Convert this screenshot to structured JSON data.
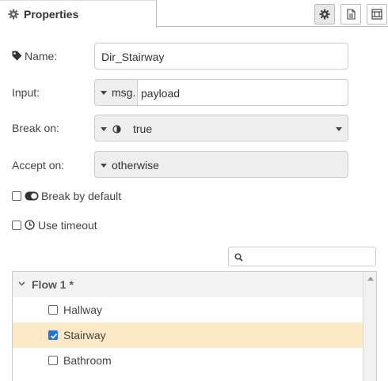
{
  "header": {
    "tab_label": "Properties",
    "buttons": [
      {
        "name": "settings",
        "icon": "gear-icon"
      },
      {
        "name": "description",
        "icon": "file-icon"
      },
      {
        "name": "appearance",
        "icon": "frame-icon"
      }
    ]
  },
  "form": {
    "name": {
      "label": "Name:",
      "value": "Dir_Stairway"
    },
    "input": {
      "label": "Input:",
      "type": "msg.",
      "value": "payload"
    },
    "break_on": {
      "label": "Break on:",
      "value": "true"
    },
    "accept_on": {
      "label": "Accept on:",
      "value": "otherwise"
    },
    "break_by_default": {
      "label": "Break by default",
      "checked": false
    },
    "use_timeout": {
      "label": "Use timeout",
      "checked": false
    }
  },
  "search": {
    "placeholder": ""
  },
  "tree": {
    "flow": {
      "label": "Flow 1 *",
      "expanded": true
    },
    "items": [
      {
        "label": "Hallway",
        "checked": false,
        "selected": false
      },
      {
        "label": "Stairway",
        "checked": true,
        "selected": true
      },
      {
        "label": "Bathroom",
        "checked": false,
        "selected": false
      }
    ]
  },
  "colors": {
    "selected_row": "#fde9c6",
    "checkbox_checked": "#1a73e8"
  }
}
